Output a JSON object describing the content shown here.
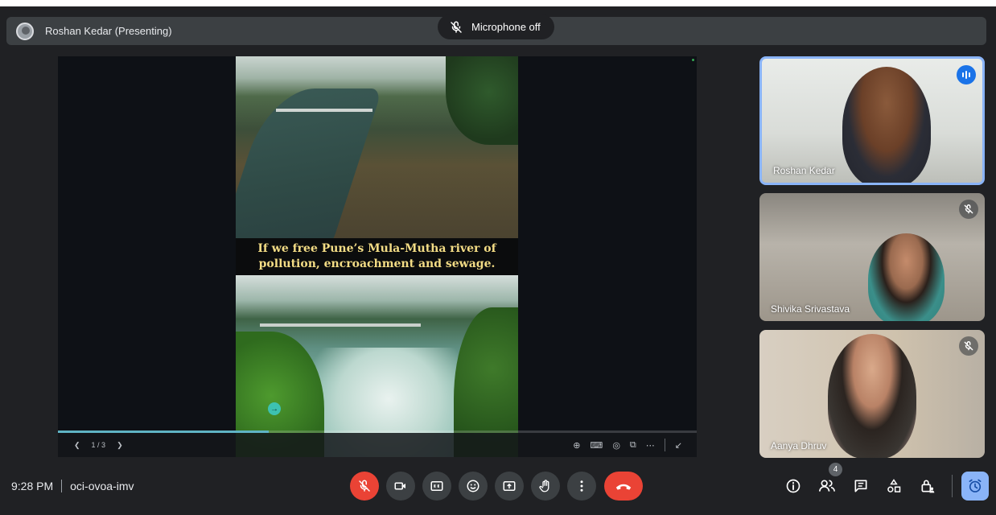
{
  "presenter": {
    "label": "Roshan Kedar (Presenting)"
  },
  "mic_status": {
    "label": "Microphone off"
  },
  "slide": {
    "caption_line1": "If we free Pune’s Mula-Mutha river of",
    "caption_line2": "pollution, encroachment and sewage.",
    "page_indicator": "1 / 3",
    "progress_fraction": 0.33
  },
  "participants": [
    {
      "name": "Roshan Kedar",
      "status": "speaking"
    },
    {
      "name": "Shivika Srivastava",
      "status": "muted"
    },
    {
      "name": "Aanya Dhruv",
      "status": "muted"
    }
  ],
  "meeting": {
    "time": "9:28 PM",
    "code": "oci-ovoa-imv",
    "participant_count": "4"
  },
  "controls": {
    "mic": "mic-off-icon",
    "camera": "camera-icon",
    "captions": "captions-icon",
    "reactions": "emoji-icon",
    "present": "present-icon",
    "raise_hand": "hand-icon",
    "more": "more-vert-icon",
    "leave": "call-end-icon"
  },
  "colors": {
    "accent": "#8ab4f8",
    "danger": "#ea4335",
    "caption_text": "#f3dc85"
  }
}
